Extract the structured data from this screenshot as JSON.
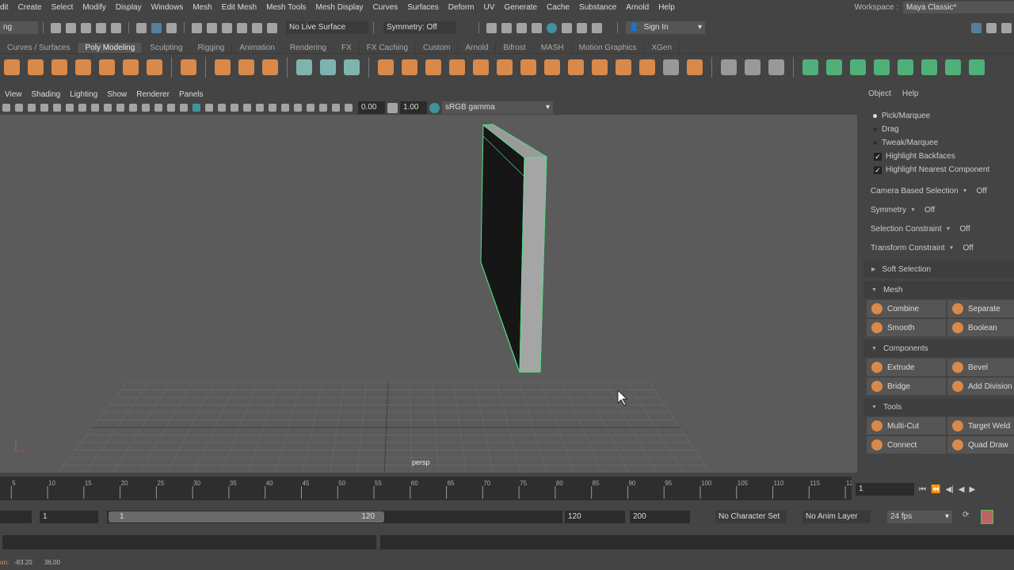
{
  "menubar": {
    "items": [
      "Create",
      "Select",
      "Modify",
      "Display",
      "Windows",
      "Mesh",
      "Edit Mesh",
      "Mesh Tools",
      "Mesh Display",
      "Curves",
      "Surfaces",
      "Deform",
      "UV",
      "Generate",
      "Cache",
      "Substance",
      "Arnold",
      "Help"
    ],
    "first_partial": "dit",
    "workspace_label": "Workspace :",
    "workspace_value": "Maya Classic*"
  },
  "statusline": {
    "mode_value": "ng",
    "live_surface": "No Live Surface",
    "symmetry": "Symmetry: Off",
    "sign_in": "Sign In"
  },
  "shelf": {
    "tabs": [
      "Curves / Surfaces",
      "Poly Modeling",
      "Sculpting",
      "Rigging",
      "Animation",
      "Rendering",
      "FX",
      "FX Caching",
      "Custom",
      "Arnold",
      "Bifrost",
      "MASH",
      "Motion Graphics",
      "XGen"
    ],
    "active_tab": "Poly Modeling",
    "icons": [
      {
        "n": "poly-sphere-icon",
        "c": "#d9894a"
      },
      {
        "n": "poly-cube-icon",
        "c": "#d9894a"
      },
      {
        "n": "poly-cylinder-icon",
        "c": "#d9894a"
      },
      {
        "n": "poly-cone-icon",
        "c": "#d9894a"
      },
      {
        "n": "poly-torus-icon",
        "c": "#d9894a"
      },
      {
        "n": "poly-plane-icon",
        "c": "#d9894a"
      },
      {
        "n": "poly-disc-icon",
        "c": "#d9894a"
      },
      {
        "n": "sep"
      },
      {
        "n": "platonic-solid-icon",
        "c": "#d9894a"
      },
      {
        "n": "sep"
      },
      {
        "n": "super-shape-icon",
        "c": "#d9894a"
      },
      {
        "n": "type-icon",
        "c": "#d9894a"
      },
      {
        "n": "svg-icon",
        "c": "#d9894a"
      },
      {
        "n": "sep"
      },
      {
        "n": "center-pivot-icon",
        "c": "#7fb3b0"
      },
      {
        "n": "delete-history-icon",
        "c": "#7fb3b0"
      },
      {
        "n": "freeze-transforms-icon",
        "c": "#7fb3b0"
      },
      {
        "n": "sep"
      },
      {
        "n": "combine-icon",
        "c": "#d9894a"
      },
      {
        "n": "separate-icon",
        "c": "#d9894a"
      },
      {
        "n": "extract-icon",
        "c": "#d9894a"
      },
      {
        "n": "smooth-icon",
        "c": "#d9894a"
      },
      {
        "n": "average-icon",
        "c": "#d9894a"
      },
      {
        "n": "extrude-icon",
        "c": "#d9894a"
      },
      {
        "n": "bridge-icon",
        "c": "#d9894a"
      },
      {
        "n": "bevel-icon",
        "c": "#d9894a"
      },
      {
        "n": "add-division-icon",
        "c": "#d9894a"
      },
      {
        "n": "boolean-icon",
        "c": "#d9894a"
      },
      {
        "n": "bevel-face-icon",
        "c": "#d9894a"
      },
      {
        "n": "append-icon",
        "c": "#d9894a"
      },
      {
        "n": "target-weld-icon",
        "c": "#999"
      },
      {
        "n": "fill-hole-icon",
        "c": "#d9894a"
      },
      {
        "n": "sep"
      },
      {
        "n": "multi-cut-icon",
        "c": "#999"
      },
      {
        "n": "insert-edge-loop-icon",
        "c": "#999"
      },
      {
        "n": "quad-draw-icon",
        "c": "#999"
      },
      {
        "n": "sep"
      },
      {
        "n": "planar-uv-icon",
        "c": "#4fb07a"
      },
      {
        "n": "cylindrical-uv-icon",
        "c": "#4fb07a"
      },
      {
        "n": "spherical-uv-icon",
        "c": "#4fb07a"
      },
      {
        "n": "auto-uv-icon",
        "c": "#4fb07a"
      },
      {
        "n": "contour-uv-icon",
        "c": "#4fb07a"
      },
      {
        "n": "uv-editor-icon",
        "c": "#4fb07a"
      },
      {
        "n": "cut-uv-icon",
        "c": "#4fb07a"
      },
      {
        "n": "sew-uv-icon",
        "c": "#4fb07a"
      }
    ]
  },
  "panel": {
    "menus": [
      "View",
      "Shading",
      "Lighting",
      "Show",
      "Renderer",
      "Panels"
    ],
    "exposure": "0.00",
    "gamma": "1.00",
    "color_space": "sRGB gamma",
    "camera_label": "persp"
  },
  "modeling_toolkit": {
    "menus": [
      "Object",
      "Help"
    ],
    "radios": [
      {
        "label": "Pick/Marquee",
        "on": true
      },
      {
        "label": "Drag",
        "on": false
      },
      {
        "label": "Tweak/Marquee",
        "on": false
      }
    ],
    "checks": [
      {
        "label": "Highlight Backfaces",
        "check": "✓"
      },
      {
        "label": "Highlight Nearest Component",
        "check": "✓"
      }
    ],
    "options": [
      {
        "label": "Camera Based Selection",
        "value": "Off"
      },
      {
        "label": "Symmetry",
        "value": "Off"
      },
      {
        "label": "Selection Constraint",
        "value": "Off"
      },
      {
        "label": "Transform Constraint",
        "value": "Off"
      }
    ],
    "soft_selection": "Soft Selection",
    "sections": [
      {
        "title": "Mesh",
        "buttons": [
          "Combine",
          "Separate",
          "Smooth",
          "Boolean"
        ]
      },
      {
        "title": "Components",
        "buttons": [
          "Extrude",
          "Bevel",
          "Bridge",
          "Add Division"
        ]
      },
      {
        "title": "Tools",
        "buttons": [
          "Multi-Cut",
          "Target Weld",
          "Connect",
          "Quad Draw"
        ]
      }
    ]
  },
  "timeline": {
    "start": 1,
    "end": 120,
    "tick_labels": [
      "5",
      "10",
      "15",
      "20",
      "25",
      "30",
      "35",
      "40",
      "45",
      "50",
      "55",
      "60",
      "65",
      "70",
      "75",
      "80",
      "85",
      "90",
      "95",
      "100",
      "105",
      "110",
      "115",
      "120"
    ],
    "current_frame": "1"
  },
  "range": {
    "start": "1",
    "slider_start": "1",
    "slider_end": "120",
    "end": "120",
    "anim_end": "200",
    "character_set": "No Character Set",
    "anim_layer": "No Anim Layer",
    "fps": "24 fps"
  },
  "help_line": {
    "label": "on:",
    "x": "-83.20",
    "y": "36.00"
  }
}
